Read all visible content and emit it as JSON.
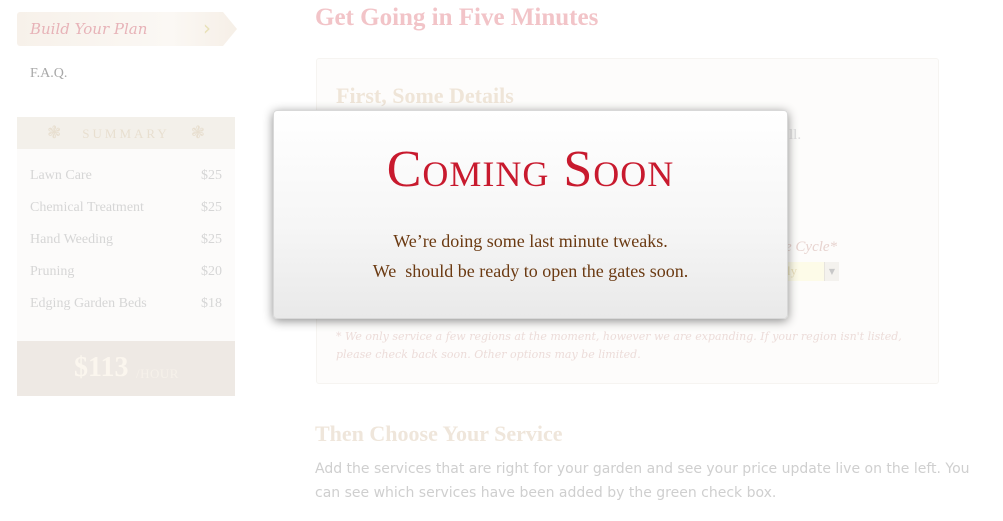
{
  "sidebar": {
    "build_plan_label": "Build Your Plan",
    "faq_label": "F.A.Q.",
    "summary": {
      "title": "SUMMARY",
      "items": [
        {
          "name": "Lawn Care",
          "price": "$25"
        },
        {
          "name": "Chemical Treatment",
          "price": "$25"
        },
        {
          "name": "Hand Weeding",
          "price": "$25"
        },
        {
          "name": "Pruning",
          "price": "$20"
        },
        {
          "name": "Edging Garden Beds",
          "price": "$18"
        }
      ],
      "total": "$113",
      "total_unit": "/HOUR"
    }
  },
  "main": {
    "heading": "Get Going in Five Minutes",
    "details": {
      "heading": "First, Some Details",
      "trailing_text": "ll.",
      "cycle_label": "e Cycle*",
      "cycle_value": "ly",
      "region_note": "* We only service a few regions at the moment, however we are expanding. If your region isn't listed, please check back soon. Other options may be limited."
    },
    "service": {
      "heading": "Then Choose Your Service",
      "description": "Add the services that are right for your garden and see your price update live on the left. You can see which services have been added by the green check box."
    }
  },
  "modal": {
    "title": "Coming Soon",
    "line1": "We’re doing some last minute tweaks.",
    "line2": "We  should be ready to open the gates soon."
  },
  "colors": {
    "modal_title": "#c81a2e",
    "modal_text": "#6b3a12",
    "heading_faded": "#f2c4c8"
  }
}
